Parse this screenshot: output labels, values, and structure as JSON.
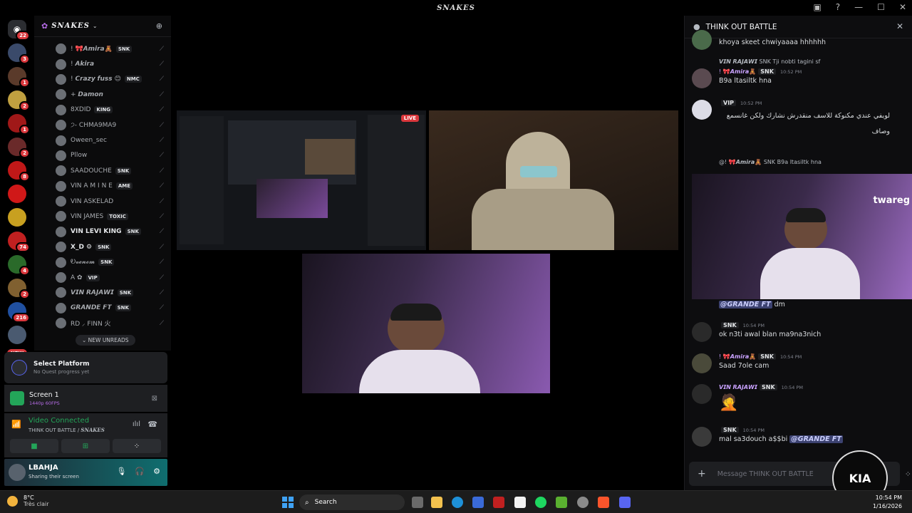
{
  "window": {
    "title": "SNAKES"
  },
  "rail": {
    "home_badge": "22",
    "servers": [
      {
        "color": "#3a4a6a",
        "badge": "3"
      },
      {
        "color": "#5a3a2a",
        "badge": "1"
      },
      {
        "color": "#c0a040",
        "badge": "2"
      },
      {
        "color": "#a01818",
        "badge": "1"
      },
      {
        "color": "#6a2a2a",
        "badge": "2"
      },
      {
        "color": "#c01818",
        "badge": "8"
      },
      {
        "color": "#d01818",
        "badge": ""
      },
      {
        "color": "#c8a020",
        "badge": ""
      },
      {
        "color": "#c02020",
        "badge": "74"
      },
      {
        "color": "#2a6a2a",
        "badge": "4"
      },
      {
        "color": "#806030",
        "badge": "2"
      },
      {
        "color": "#2050a0",
        "badge": "216"
      },
      {
        "color": "#4a5a70",
        "badge": ""
      }
    ],
    "new_label": "NEW"
  },
  "guild": {
    "name": "SNAKES"
  },
  "members": [
    {
      "name": "! 🎀𝘼𝙢𝙞𝙧𝙖🧸",
      "tag": "SNK",
      "bold": false
    },
    {
      "name": "! 𝘼𝙠𝙞𝙧𝙖",
      "tag": "",
      "bold": false
    },
    {
      "name": "! 𝘾𝙧𝙖𝙯𝙮 𝙛𝙪𝙨𝙨 😊",
      "tag": "NMC",
      "bold": false
    },
    {
      "name": "+ 𝘿𝙖𝙢𝙤𝙣",
      "tag": "",
      "bold": false
    },
    {
      "name": "8XDID",
      "tag": "KING",
      "bold": false
    },
    {
      "name": "੭- CHMA9MA9",
      "tag": "",
      "bold": false
    },
    {
      "name": "Oween_sec",
      "tag": "",
      "bold": false
    },
    {
      "name": "Pllow",
      "tag": "",
      "bold": false
    },
    {
      "name": "SAADOUCHE",
      "tag": "SNK",
      "bold": false
    },
    {
      "name": "VIN A M I N E",
      "tag": "AME",
      "bold": false
    },
    {
      "name": "VIN ASKELAD",
      "tag": "",
      "bold": false
    },
    {
      "name": "VIN JAMES",
      "tag": "TOXIC",
      "bold": false
    },
    {
      "name": "VIN LEVI KING",
      "tag": "SNK",
      "bold": true
    },
    {
      "name": "X_D ⚙",
      "tag": "SNK",
      "bold": true
    },
    {
      "name": "Ꭷ𝓿𝓮𝓷𝓸𝓶",
      "tag": "SNK",
      "bold": false
    },
    {
      "name": "A ✿",
      "tag": "VIP",
      "bold": false
    },
    {
      "name": "𝙑𝙄𝙉 𝙍𝘼𝙅𝘼𝙒𝙄",
      "tag": "SNK",
      "bold": false
    },
    {
      "name": "𝙂𝙍𝘼𝙉𝘿𝙀 𝙁𝙏",
      "tag": "SNK",
      "bold": false
    },
    {
      "name": "RD ⸝ FINN 火",
      "tag": "",
      "bold": false
    }
  ],
  "new_unreads": "NEW UNREADS",
  "quest": {
    "title": "Select Platform",
    "subtitle": "No Quest progress yet"
  },
  "screen_share": {
    "title": "Screen 1",
    "quality": "1440p 60FPS"
  },
  "voice": {
    "status": "Video Connected",
    "channel": "THINK OUT BATTLE / ",
    "guild": "SNAKES"
  },
  "user": {
    "name": "LBAHJA",
    "status": "Sharing their screen"
  },
  "stage": {
    "live": "LIVE"
  },
  "chat": {
    "title": "THINK OUT BATTLE",
    "m0": {
      "body": "khoya skeet chwiyaaaa hhhhhh"
    },
    "m1": {
      "reply": "𝙑𝙄𝙉 𝙍𝘼𝙅𝘼𝙒𝙄  SNK  Tji nobti tagini sf",
      "name": "! 🎀𝘼𝙢𝙞𝙧𝙖🧸",
      "tag": "SNK",
      "ts": "10:52 PM",
      "body": "B9a ltasiltk hna"
    },
    "m2": {
      "name": "",
      "tag": "VIP",
      "ts": "10:52 PM",
      "body": "لويفي عندي مكنوكة للاسف منقدرش نشارك ولكن غانسمع وصاف"
    },
    "m3": {
      "reply": "@! 🎀𝘼𝙢𝙞𝙧𝙖🧸  SNK  B9a ltasiltk hna"
    },
    "m4": {
      "mention": "@GRANDE FT",
      "body": " dm"
    },
    "m5": {
      "name": "",
      "tag": "SNK",
      "ts": "10:54 PM",
      "body": "ok n3ti awal blan ma9na3nich"
    },
    "m6": {
      "name": "! 🎀𝘼𝙢𝙞𝙧𝙖🧸",
      "tag": "SNK",
      "ts": "10:54 PM",
      "body": "Saad 7ole cam"
    },
    "m7": {
      "name": "𝙑𝙄𝙉 𝙍𝘼𝙅𝘼𝙒𝙄",
      "tag": "SNK",
      "ts": "10:54 PM",
      "body": "🤦"
    },
    "m8": {
      "name": "",
      "tag": "SNK",
      "ts": "10:54 PM",
      "body": "mal sa3douch a$$bi ",
      "mention": "@GRANDE FT"
    },
    "composer_placeholder": "Message THINK OUT BATTLE"
  },
  "overlay_brand": "twareg",
  "taskbar": {
    "temp": "8°C",
    "condition": "Très clair",
    "search": "Search",
    "time": "10:54 PM",
    "date": "1/16/2026"
  }
}
